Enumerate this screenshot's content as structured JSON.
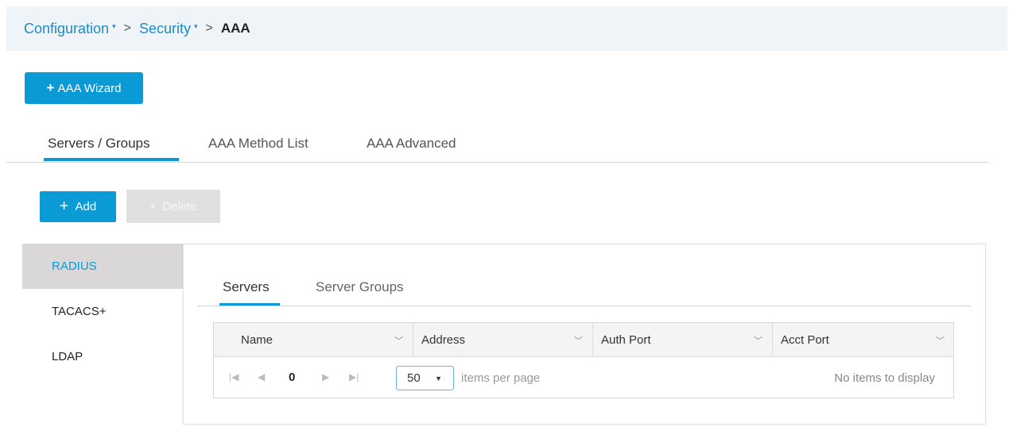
{
  "breadcrumb": {
    "items": [
      {
        "label": "Configuration",
        "caret": "▾"
      },
      {
        "label": "Security",
        "caret": "▾"
      }
    ],
    "separator": ">",
    "current": "AAA"
  },
  "wizard_button": {
    "icon": "plus-icon",
    "label": "AAA Wizard"
  },
  "main_tabs": [
    {
      "label": "Servers / Groups",
      "active": true
    },
    {
      "label": "AAA Method List",
      "active": false
    },
    {
      "label": "AAA Advanced",
      "active": false
    }
  ],
  "toolbar": {
    "add_label": "Add",
    "delete_label": "Delete"
  },
  "side_list": [
    {
      "label": "RADIUS",
      "active": true
    },
    {
      "label": "TACACS+",
      "active": false
    },
    {
      "label": "LDAP",
      "active": false
    }
  ],
  "sub_tabs": [
    {
      "label": "Servers",
      "active": true
    },
    {
      "label": "Server Groups",
      "active": false
    }
  ],
  "grid": {
    "columns": [
      "Name",
      "Address",
      "Auth Port",
      "Acct Port"
    ],
    "page_number": "0",
    "page_size": "50",
    "per_page_label": "items per page",
    "empty_message": "No items to display"
  },
  "colors": {
    "accent": "#0a9ad6",
    "breadcrumb_bg": "#eef4f8",
    "active_side_bg": "#d9d7d7"
  }
}
